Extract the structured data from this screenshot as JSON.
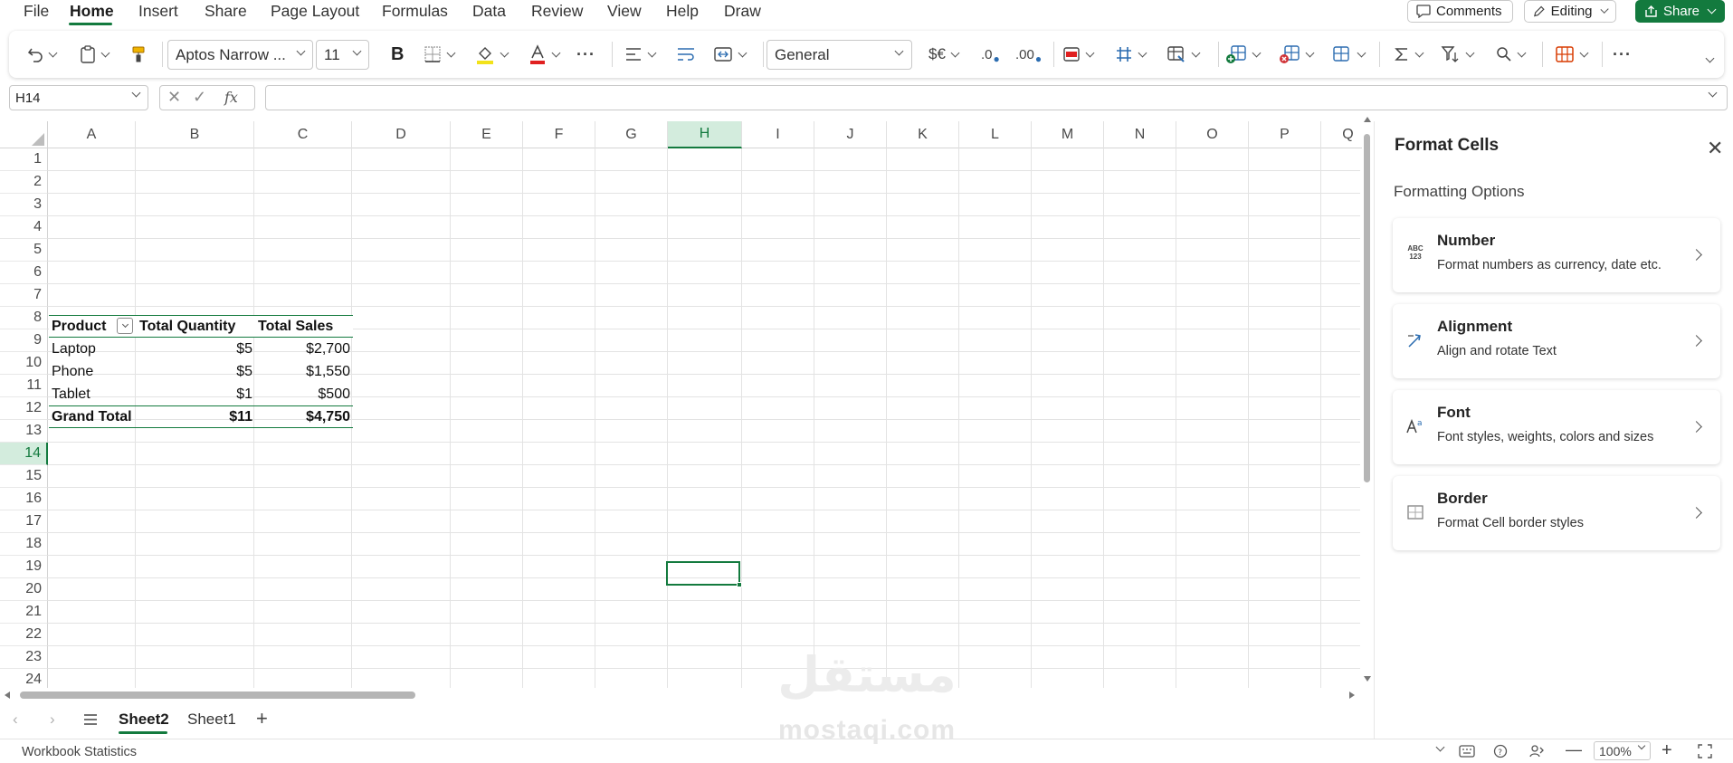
{
  "menu": {
    "items": [
      "File",
      "Home",
      "Insert",
      "Share",
      "Page Layout",
      "Formulas",
      "Data",
      "Review",
      "View",
      "Help",
      "Draw"
    ],
    "active": "Home",
    "comments_label": "Comments",
    "editing_label": "Editing",
    "share_label": "Share"
  },
  "ribbon": {
    "font_name": "Aptos Narrow ...",
    "font_size": "11",
    "bold_label": "B",
    "number_format": "General",
    "currency_label": "$€",
    "dec_increase_label": ".0",
    "dec_decrease_label": ".00",
    "more_label": "···",
    "fill_color": "#f2e21a",
    "font_color": "#e02020"
  },
  "formula_bar": {
    "name_box": "H14",
    "fx_label": "fx",
    "formula": ""
  },
  "grid": {
    "columns": [
      "A",
      "B",
      "C",
      "D",
      "E",
      "F",
      "G",
      "H",
      "I",
      "J",
      "K",
      "L",
      "M",
      "N",
      "O",
      "P",
      "Q"
    ],
    "selected_column": "H",
    "rows": [
      "1",
      "2",
      "3",
      "4",
      "5",
      "6",
      "7",
      "8",
      "9",
      "10",
      "11",
      "12",
      "13",
      "14",
      "15",
      "16",
      "17",
      "18",
      "19",
      "20",
      "21",
      "22",
      "23",
      "24"
    ],
    "selected_row": "14",
    "pivot": {
      "headers": [
        "Product",
        "Total Quantity",
        "Total Sales"
      ],
      "rows": [
        [
          "Laptop",
          "$5",
          "$2,700"
        ],
        [
          "Phone",
          "$5",
          "$1,550"
        ],
        [
          "Tablet",
          "$1",
          "$500"
        ]
      ],
      "total": [
        "Grand Total",
        "$11",
        "$4,750"
      ]
    }
  },
  "panel": {
    "title": "Format Cells",
    "subtitle": "Formatting Options",
    "cards": [
      {
        "title": "Number",
        "desc": "Format numbers as currency, date etc.",
        "icon": "number-format-icon"
      },
      {
        "title": "Alignment",
        "desc": "Align and rotate Text",
        "icon": "alignment-icon"
      },
      {
        "title": "Font",
        "desc": "Font styles, weights, colors and sizes",
        "icon": "font-icon"
      },
      {
        "title": "Border",
        "desc": "Format Cell border styles",
        "icon": "border-icon"
      }
    ],
    "number_icon_text_top": "ABC",
    "number_icon_text_bottom": "123"
  },
  "sheets": {
    "tabs": [
      "Sheet2",
      "Sheet1"
    ],
    "active": "Sheet2",
    "add_label": "+"
  },
  "watermark": {
    "arabic": "مستقل",
    "latin": "mostaqi.com"
  },
  "status": {
    "left": "Workbook Statistics",
    "zoom": "100%"
  }
}
